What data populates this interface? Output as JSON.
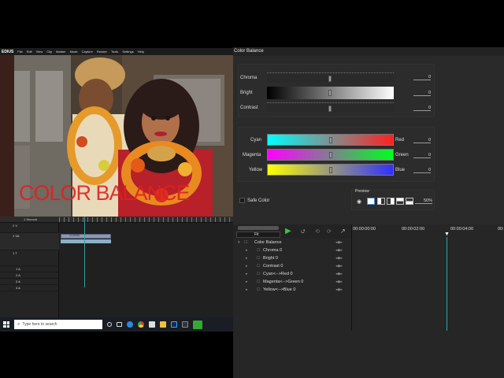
{
  "edius": {
    "logo": "EDIUS",
    "menu": [
      "File",
      "Edit",
      "View",
      "Clip",
      "Marker",
      "Mode",
      "Capture",
      "Render",
      "Tools",
      "Settings",
      "Help"
    ],
    "overlay_text": "COLOR BALANCE",
    "timeline_scale": "1 Second",
    "tracks": [
      "2 V",
      "1 VA",
      "1 T",
      "1 A",
      "2 A",
      "3 A",
      "4 A"
    ],
    "clip_label": "CC0000"
  },
  "taskbar": {
    "search_placeholder": "Type here to search"
  },
  "color_balance": {
    "title": "Color Balance",
    "chroma": {
      "label": "Chroma",
      "value": "0"
    },
    "bright": {
      "label": "Bright",
      "value": "0"
    },
    "contrast": {
      "label": "Contrast",
      "value": "0"
    },
    "cyan_red": {
      "left": "Cyan",
      "right": "Red",
      "value": "0"
    },
    "magenta_green": {
      "left": "Magenta",
      "right": "Green",
      "value": "0"
    },
    "yellow_blue": {
      "left": "Yellow",
      "right": "Blue",
      "value": "0"
    },
    "safe_color": "Safe Color",
    "preview_label": "Preview",
    "preview_zoom": "50%"
  },
  "keyframe": {
    "fit_label": "Fit",
    "timecodes": [
      "00:00:00:00",
      "00:00:02:00",
      "00:00:04:00",
      "00:"
    ],
    "tree": [
      "Color Balance",
      "Chroma 0",
      "Bright 0",
      "Contrast 0",
      "Cyan<-->Red 0",
      "Magenta<-->Green 0",
      "Yellow<-->Blue 0"
    ]
  }
}
